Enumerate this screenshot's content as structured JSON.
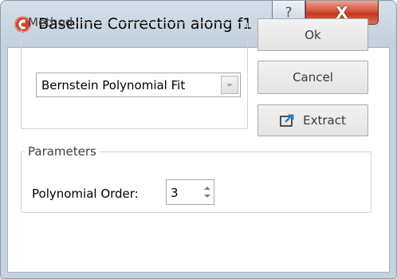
{
  "window": {
    "title": "Baseline Correction along f1",
    "help_glyph": "?",
    "close_glyph": "X",
    "icon": "app-logo-icon"
  },
  "method": {
    "legend": "Method",
    "selected": "Bernstein Polynomial Fit"
  },
  "buttons": {
    "ok": "Ok",
    "cancel": "Cancel",
    "extract": "Extract",
    "extract_icon": "export-arrow-icon"
  },
  "parameters": {
    "legend": "Parameters",
    "polynomial_order_label": "Polynomial Order:",
    "polynomial_order_value": "3"
  },
  "colors": {
    "close_button": "#d6543b",
    "titlebar": "#c6d2de",
    "extract_icon_accent": "#2a7fd4"
  }
}
